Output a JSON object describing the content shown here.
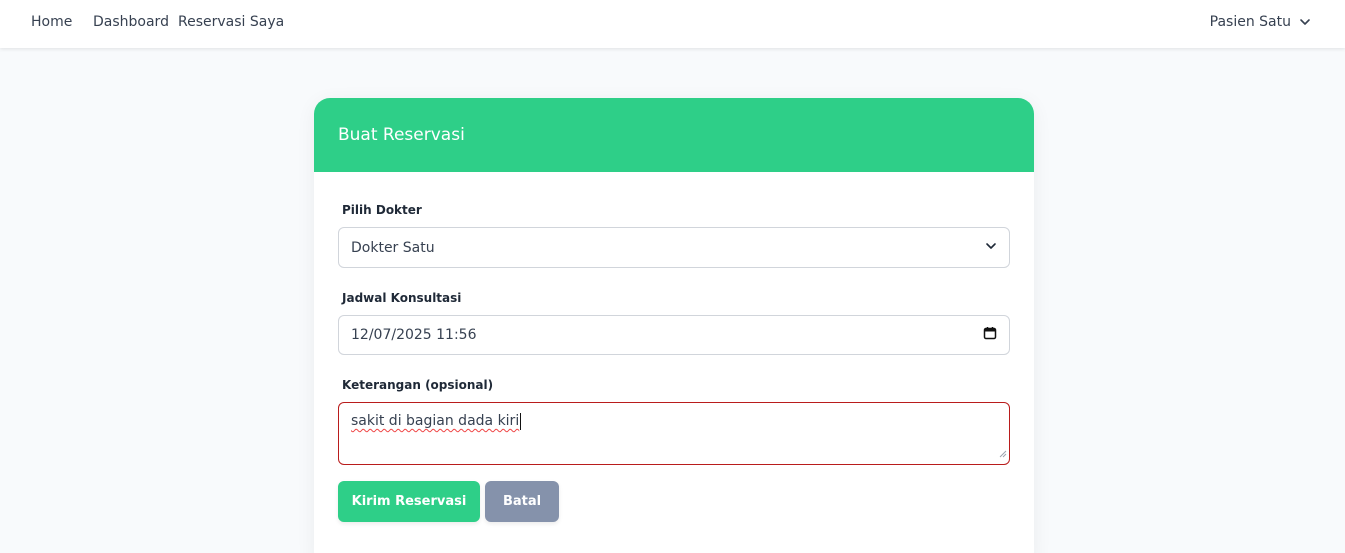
{
  "nav": {
    "home": "Home",
    "dashboard": "Dashboard",
    "my_reservations": "Reservasi Saya",
    "user_name": "Pasien Satu"
  },
  "form": {
    "title": "Buat Reservasi",
    "doctor": {
      "label": "Pilih Dokter",
      "value": "Dokter Satu"
    },
    "schedule": {
      "label": "Jadwal Konsultasi",
      "value": "12/07/2025 11:56"
    },
    "notes": {
      "label": "Keterangan (opsional)",
      "value": "sakit di bagian dada kiri"
    },
    "submit_label": "Kirim Reservasi",
    "cancel_label": "Batal"
  },
  "colors": {
    "accent": "#2ecf88",
    "cancel_button": "#8592ab",
    "invalid_border": "#b91c1c"
  },
  "icons": {
    "user_menu": "chevron-down-icon",
    "select": "chevron-down-icon",
    "date": "calendar-icon"
  }
}
